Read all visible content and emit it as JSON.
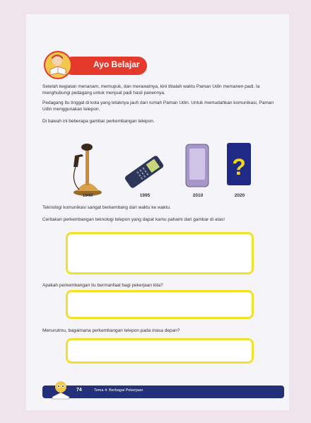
{
  "header": {
    "title": "Ayo Belajar"
  },
  "paragraphs": {
    "p1": "Setelah kegiatan menanam, memupuk, dan merawatnya, kini tibalah waktu Paman Udin memanen padi. Ia menghubungi pedagang untuk menjual padi hasil panennya.",
    "p2": "Pedagang itu tinggal di kota yang letaknya jauh dari rumah Paman Udin. Untuk memudahkan komunikasi, Paman Udin menggunakan telepon.",
    "p3": "Di bawah ini beberapa gambar perkembangan telepon."
  },
  "years": [
    "1940",
    "1995",
    "2010",
    "2020"
  ],
  "questions": {
    "intro": "Teknologi komunikasi sangat berkembang dari waktu ke waktu.",
    "q1": "Ceritakan perkembangan teknologi telepon yang dapat kamu pahami dari gambar di atas!",
    "q2": "Apakah perkembangan itu bermanfaat bagi pekerjaan kita?",
    "q3": "Menurutmu, bagaimana perkembangan telepon pada masa depan?"
  },
  "mystery_phone": "?",
  "footer": {
    "page_number": "74",
    "theme": "Tema 4: Berbagai Pekerjaan"
  }
}
